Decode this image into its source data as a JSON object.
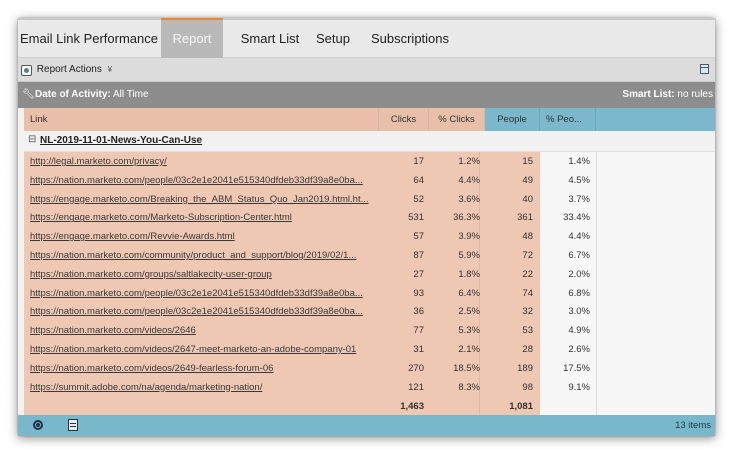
{
  "tabs": [
    {
      "label": "Email Link Performance",
      "active": false
    },
    {
      "label": "Report",
      "active": true
    },
    {
      "label": "Smart List",
      "active": false
    },
    {
      "label": "Setup",
      "active": false
    },
    {
      "label": "Subscriptions",
      "active": false
    }
  ],
  "toolbar": {
    "report_actions_label": "Report Actions",
    "report_actions_icon": "report-actions-icon",
    "dropdown_icon": "chevron-down-icon",
    "export_icon": "export-icon"
  },
  "filter": {
    "date_label": "Date of Activity:",
    "date_value": "All Time",
    "smart_list_label": "Smart List:",
    "smart_list_value": "no rules"
  },
  "columns": {
    "link": "Link",
    "clicks": "Clicks",
    "pct_clicks": "% Clicks",
    "people": "People",
    "pct_people": "% Peo..."
  },
  "group": {
    "toggle": "⊟",
    "name": "NL-2019-11-01-News-You-Can-Use"
  },
  "rows": [
    {
      "link": "http://legal.marketo.com/privacy/",
      "clicks": "17",
      "pct_clicks": "1.2%",
      "people": "15",
      "pct_people": "1.4%"
    },
    {
      "link": "https://nation.marketo.com/people/03c2e1e2041e515340dfdeb33df39a8e0ba...",
      "clicks": "64",
      "pct_clicks": "4.4%",
      "people": "49",
      "pct_people": "4.5%"
    },
    {
      "link": "https://engage.marketo.com/Breaking_the_ABM_Status_Quo_Jan2019.html.ht...",
      "clicks": "52",
      "pct_clicks": "3.6%",
      "people": "40",
      "pct_people": "3.7%"
    },
    {
      "link": "https://engage.marketo.com/Marketo-Subscription-Center.html",
      "clicks": "531",
      "pct_clicks": "36.3%",
      "people": "361",
      "pct_people": "33.4%"
    },
    {
      "link": "https://engage.marketo.com/Revvie-Awards.html",
      "clicks": "57",
      "pct_clicks": "3.9%",
      "people": "48",
      "pct_people": "4.4%"
    },
    {
      "link": "https://nation.marketo.com/community/product_and_support/blog/2019/02/1...",
      "clicks": "87",
      "pct_clicks": "5.9%",
      "people": "72",
      "pct_people": "6.7%"
    },
    {
      "link": "https://nation.marketo.com/groups/saltlakecity-user-group",
      "clicks": "27",
      "pct_clicks": "1.8%",
      "people": "22",
      "pct_people": "2.0%"
    },
    {
      "link": "https://nation.marketo.com/people/03c2e1e2041e515340dfdeb33df39a8e0ba...",
      "clicks": "93",
      "pct_clicks": "6.4%",
      "people": "74",
      "pct_people": "6.8%"
    },
    {
      "link": "https://nation.marketo.com/people/03c2e1e2041e515340dfdeb33df39a8e0ba...",
      "clicks": "36",
      "pct_clicks": "2.5%",
      "people": "32",
      "pct_people": "3.0%"
    },
    {
      "link": "https://nation.marketo.com/videos/2646",
      "clicks": "77",
      "pct_clicks": "5.3%",
      "people": "53",
      "pct_people": "4.9%"
    },
    {
      "link": "https://nation.marketo.com/videos/2647-meet-marketo-an-adobe-company-01",
      "clicks": "31",
      "pct_clicks": "2.1%",
      "people": "28",
      "pct_people": "2.6%"
    },
    {
      "link": "https://nation.marketo.com/videos/2649-fearless-forum-06",
      "clicks": "270",
      "pct_clicks": "18.5%",
      "people": "189",
      "pct_people": "17.5%"
    },
    {
      "link": "https://summit.adobe.com/na/agenda/marketing-nation/",
      "clicks": "121",
      "pct_clicks": "8.3%",
      "people": "98",
      "pct_people": "9.1%"
    }
  ],
  "totals": {
    "clicks": "1,463",
    "people": "1,081"
  },
  "footer": {
    "refresh_icon": "refresh-icon",
    "export_icon": "spreadsheet-icon",
    "item_count": "13 items"
  },
  "colors": {
    "peach": "#e9bfa9",
    "blue": "#7cb8cc",
    "active_tab": "#b9b9b9",
    "accent": "#e88a3c"
  }
}
